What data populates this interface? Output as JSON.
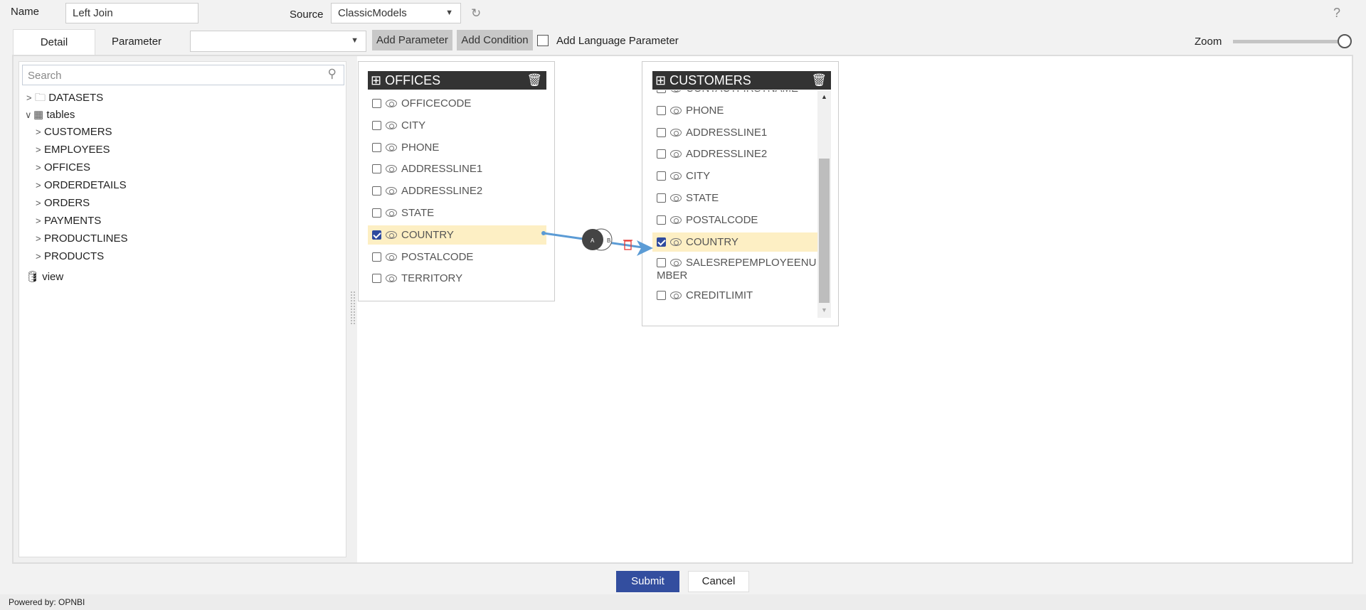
{
  "header": {
    "name_label": "Name",
    "name_value": "Left Join",
    "source_label": "Source",
    "source_value": "ClassicModels",
    "help": "?"
  },
  "tabs": [
    {
      "label": "Detail",
      "active": true
    },
    {
      "label": "Parameter",
      "active": false
    }
  ],
  "toolbar": {
    "parameter_select_value": "",
    "add_parameter": "Add Parameter",
    "add_condition": "Add Condition",
    "add_language_parameter": "Add Language Parameter",
    "add_language_checked": false,
    "zoom_label": "Zoom",
    "zoom_percent": 100
  },
  "tree": {
    "search_placeholder": "Search",
    "datasets": "DATASETS",
    "tables": "tables",
    "table_items": [
      "CUSTOMERS",
      "EMPLOYEES",
      "OFFICES",
      "ORDERDETAILS",
      "ORDERS",
      "PAYMENTS",
      "PRODUCTLINES",
      "PRODUCTS"
    ],
    "view": "view"
  },
  "offices": {
    "title": "OFFICES",
    "columns": [
      {
        "name": "OFFICECODE",
        "checked": false
      },
      {
        "name": "CITY",
        "checked": false
      },
      {
        "name": "PHONE",
        "checked": false
      },
      {
        "name": "ADDRESSLINE1",
        "checked": false
      },
      {
        "name": "ADDRESSLINE2",
        "checked": false
      },
      {
        "name": "STATE",
        "checked": false
      },
      {
        "name": "COUNTRY",
        "checked": true
      },
      {
        "name": "POSTALCODE",
        "checked": false
      },
      {
        "name": "TERRITORY",
        "checked": false
      }
    ]
  },
  "customers": {
    "title": "CUSTOMERS",
    "columns": [
      {
        "name": "CONTACTFIRSTNAME",
        "checked": false
      },
      {
        "name": "PHONE",
        "checked": false
      },
      {
        "name": "ADDRESSLINE1",
        "checked": false
      },
      {
        "name": "ADDRESSLINE2",
        "checked": false
      },
      {
        "name": "CITY",
        "checked": false
      },
      {
        "name": "STATE",
        "checked": false
      },
      {
        "name": "POSTALCODE",
        "checked": false
      },
      {
        "name": "COUNTRY",
        "checked": true
      },
      {
        "name": "SALESREPEMPLOYEENUMBER",
        "checked": false
      },
      {
        "name": "CREDITLIMIT",
        "checked": false
      }
    ]
  },
  "join": {
    "label_a": "A",
    "label_b": "B",
    "type": "left join",
    "line_color": "#5b9bd5",
    "delete_color": "#e53935"
  },
  "footer": {
    "submit": "Submit",
    "cancel": "Cancel",
    "powered_by": "Powered by: OPNBI"
  },
  "colors": {
    "accent": "#2e4a9e",
    "highlight": "#fdefc4",
    "card_header": "#333333"
  }
}
